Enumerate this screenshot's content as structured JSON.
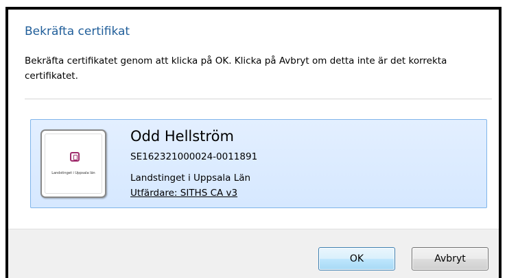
{
  "dialog": {
    "title": "Bekräfta certifikat",
    "description": "Bekräfta certifikatet genom att klicka på OK. Klicka på Avbryt om detta inte är det korrekta certifikatet."
  },
  "certificate": {
    "name": "Odd Hellström",
    "serial": "SE162321000024-0011891",
    "organization": "Landstinget i Uppsala Län",
    "issuer": "Utfärdare: SITHS CA v3",
    "thumbnail_caption": "Landstinget i Uppsala län",
    "thumbnail_icon": "organization-logo-icon"
  },
  "buttons": {
    "ok_label": "OK",
    "cancel_label": "Avbryt"
  },
  "colors": {
    "title": "#1f5d99",
    "card_background": "#dcebff",
    "card_border": "#7eb4ea",
    "footer_background": "#f0f0f0",
    "logo_accent": "#9e2a6b"
  }
}
